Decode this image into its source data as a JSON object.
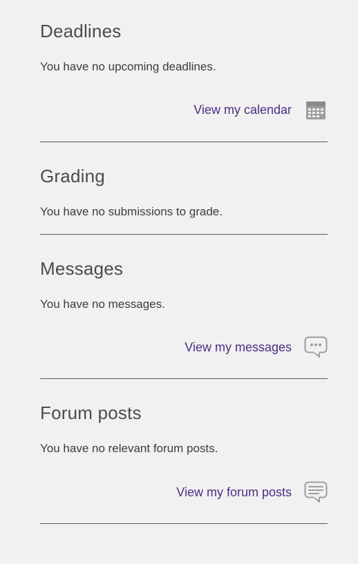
{
  "link_color": "#4b2e83",
  "icon_color": "#9e9e9e",
  "sections": {
    "deadlines": {
      "heading": "Deadlines",
      "message": "You have no upcoming deadlines.",
      "link_label": "View my calendar",
      "icon": "calendar-icon"
    },
    "grading": {
      "heading": "Grading",
      "message": "You have no submissions to grade."
    },
    "messages": {
      "heading": "Messages",
      "message": "You have no messages.",
      "link_label": "View my messages",
      "icon": "chat-icon"
    },
    "forum": {
      "heading": "Forum posts",
      "message": "You have no relevant forum posts.",
      "link_label": "View my forum posts",
      "icon": "forum-icon"
    }
  }
}
